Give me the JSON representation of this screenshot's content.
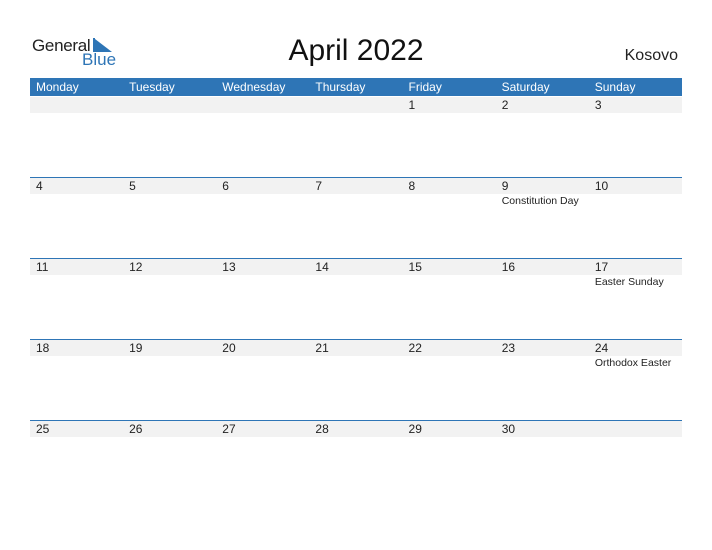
{
  "logo": {
    "general": "General",
    "blue": "Blue"
  },
  "title": "April 2022",
  "country": "Kosovo",
  "colors": {
    "accent": "#2e75b6",
    "strip": "#f2f2f2"
  },
  "weekdays": [
    "Monday",
    "Tuesday",
    "Wednesday",
    "Thursday",
    "Friday",
    "Saturday",
    "Sunday"
  ],
  "weeks": [
    [
      {
        "d": ""
      },
      {
        "d": ""
      },
      {
        "d": ""
      },
      {
        "d": ""
      },
      {
        "d": "1"
      },
      {
        "d": "2"
      },
      {
        "d": "3"
      }
    ],
    [
      {
        "d": "4"
      },
      {
        "d": "5"
      },
      {
        "d": "6"
      },
      {
        "d": "7"
      },
      {
        "d": "8"
      },
      {
        "d": "9",
        "h": "Constitution Day"
      },
      {
        "d": "10"
      }
    ],
    [
      {
        "d": "11"
      },
      {
        "d": "12"
      },
      {
        "d": "13"
      },
      {
        "d": "14"
      },
      {
        "d": "15"
      },
      {
        "d": "16"
      },
      {
        "d": "17",
        "h": "Easter Sunday"
      }
    ],
    [
      {
        "d": "18"
      },
      {
        "d": "19"
      },
      {
        "d": "20"
      },
      {
        "d": "21"
      },
      {
        "d": "22"
      },
      {
        "d": "23"
      },
      {
        "d": "24",
        "h": "Orthodox Easter"
      }
    ],
    [
      {
        "d": "25"
      },
      {
        "d": "26"
      },
      {
        "d": "27"
      },
      {
        "d": "28"
      },
      {
        "d": "29"
      },
      {
        "d": "30"
      },
      {
        "d": ""
      }
    ]
  ]
}
